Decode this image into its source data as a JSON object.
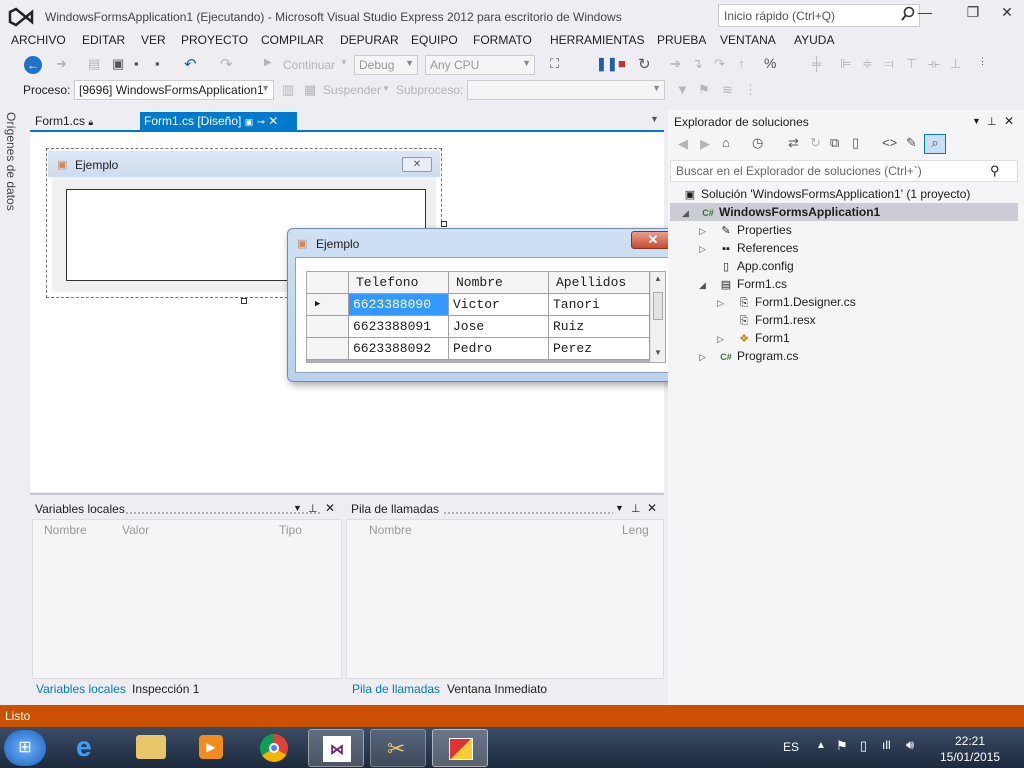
{
  "window": {
    "title": "WindowsFormsApplication1 (Ejecutando) - Microsoft Visual Studio Express 2012 para escritorio de Windows",
    "quick_launch_placeholder": "Inicio rápido (Ctrl+Q)"
  },
  "menu": [
    "ARCHIVO",
    "EDITAR",
    "VER",
    "PROYECTO",
    "COMPILAR",
    "DEPURAR",
    "EQUIPO",
    "FORMATO",
    "HERRAMIENTAS",
    "PRUEBA",
    "VENTANA",
    "AYUDA"
  ],
  "toolbar": {
    "continue_label": "Continuar",
    "config": "Debug",
    "platform": "Any CPU",
    "process_label": "Proceso:",
    "process_value": "[9696] WindowsFormsApplication1",
    "suspend_label": "Suspender",
    "thread_label": "Subproceso:"
  },
  "left_strip_label": "Orígenes de datos",
  "tabs": [
    {
      "label": "Form1.cs"
    },
    {
      "label": "Form1.cs [Diseño]"
    }
  ],
  "design_form": {
    "title": "Ejemplo"
  },
  "run_window": {
    "title": "Ejemplo",
    "grid": {
      "headers": [
        "Telefono",
        "Nombre",
        "Apellidos"
      ],
      "rows": [
        [
          "6623388090",
          "Victor",
          "Tanori"
        ],
        [
          "6623388091",
          "Jose",
          "Ruiz"
        ],
        [
          "6623388092",
          "Pedro",
          "Perez"
        ]
      ]
    }
  },
  "locals_pane": {
    "title": "Variables locales",
    "columns": [
      "Nombre",
      "Valor",
      "Tipo"
    ],
    "tabs": [
      "Variables locales",
      "Inspección 1"
    ]
  },
  "callstack_pane": {
    "title": "Pila de llamadas",
    "columns": [
      "Nombre",
      "Leng"
    ],
    "tabs": [
      "Pila de llamadas",
      "Ventana Inmediato"
    ]
  },
  "solution_explorer": {
    "title": "Explorador de soluciones",
    "search_placeholder": "Buscar en el Explorador de soluciones (Ctrl+`)",
    "items": [
      {
        "label": "Solución 'WindowsFormsApplication1' (1 proyecto)",
        "icon": "solution-icon"
      },
      {
        "label": "WindowsFormsApplication1",
        "icon": "csharp-project-icon"
      },
      {
        "label": "Properties",
        "icon": "wrench-icon"
      },
      {
        "label": "References",
        "icon": "references-icon"
      },
      {
        "label": "App.config",
        "icon": "config-file-icon"
      },
      {
        "label": "Form1.cs",
        "icon": "form-file-icon"
      },
      {
        "label": "Form1.Designer.cs",
        "icon": "designer-file-icon"
      },
      {
        "label": "Form1.resx",
        "icon": "resx-file-icon"
      },
      {
        "label": "Form1",
        "icon": "class-icon"
      },
      {
        "label": "Program.cs",
        "icon": "csharp-file-icon"
      }
    ]
  },
  "status": {
    "text": "Listo"
  },
  "taskbar": {
    "lang": "ES",
    "time": "22:21",
    "date": "15/01/2015"
  },
  "colors": {
    "accent": "#007acc",
    "statusbar": "#ca5100",
    "selection": "#3399ff"
  }
}
